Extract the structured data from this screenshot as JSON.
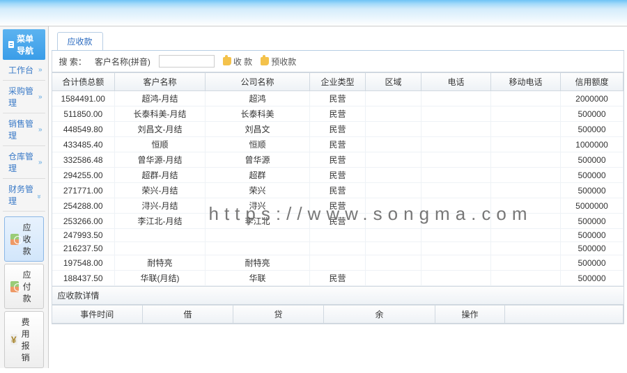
{
  "sidebar": {
    "title": "菜单导航",
    "items": [
      {
        "label": "工作台",
        "open": false
      },
      {
        "label": "采购管理",
        "open": false
      },
      {
        "label": "销售管理",
        "open": false
      },
      {
        "label": "仓库管理",
        "open": false
      },
      {
        "label": "财务管理",
        "open": true
      }
    ],
    "sub": [
      {
        "label": "应收款",
        "icon": "money",
        "active": true
      },
      {
        "label": "应付款",
        "icon": "money",
        "active": false
      },
      {
        "label": "费用报销",
        "icon": "yen",
        "active": false
      }
    ]
  },
  "tabs": {
    "active": "应收款"
  },
  "search": {
    "label": "搜 索：",
    "field_label": "客户名称(拼音)",
    "value": "",
    "action1": "收 款",
    "action2": "预收款"
  },
  "grid": {
    "columns": [
      "合计债总额",
      "客户名称",
      "公司名称",
      "企业类型",
      "区域",
      "电话",
      "移动电话",
      "信用额度"
    ],
    "rows": [
      {
        "amt": "1584491.00",
        "cust": "超鸿-月结",
        "comp": "超鸿",
        "type": "民营",
        "area": "",
        "tel": "",
        "mob": "",
        "cred": "2000000"
      },
      {
        "amt": "511850.00",
        "cust": "长泰科美-月结",
        "comp": "长泰科美",
        "type": "民营",
        "area": "",
        "tel": "",
        "mob": "",
        "cred": "500000"
      },
      {
        "amt": "448549.80",
        "cust": "刘昌文-月结",
        "comp": "刘昌文",
        "type": "民营",
        "area": "",
        "tel": "",
        "mob": "",
        "cred": "500000"
      },
      {
        "amt": "433485.40",
        "cust": "恒顺",
        "comp": "恒顺",
        "type": "民营",
        "area": "",
        "tel": "",
        "mob": "",
        "cred": "1000000"
      },
      {
        "amt": "332586.48",
        "cust": "曾华源-月结",
        "comp": "曾华源",
        "type": "民营",
        "area": "",
        "tel": "",
        "mob": "",
        "cred": "500000"
      },
      {
        "amt": "294255.00",
        "cust": "超群-月结",
        "comp": "超群",
        "type": "民营",
        "area": "",
        "tel": "",
        "mob": "",
        "cred": "500000"
      },
      {
        "amt": "271771.00",
        "cust": "荣兴-月结",
        "comp": "荣兴",
        "type": "民营",
        "area": "",
        "tel": "",
        "mob": "",
        "cred": "500000"
      },
      {
        "amt": "254288.00",
        "cust": "浔兴-月结",
        "comp": "浔兴",
        "type": "民营",
        "area": "",
        "tel": "",
        "mob": "",
        "cred": "5000000"
      },
      {
        "amt": "253266.00",
        "cust": "李江北-月结",
        "comp": "李江北",
        "type": "民营",
        "area": "",
        "tel": "",
        "mob": "",
        "cred": "500000"
      },
      {
        "amt": "247993.50",
        "cust": "",
        "comp": "",
        "type": "",
        "area": "",
        "tel": "",
        "mob": "",
        "cred": "500000"
      },
      {
        "amt": "216237.50",
        "cust": "",
        "comp": "",
        "type": "",
        "area": "",
        "tel": "",
        "mob": "",
        "cred": "500000"
      },
      {
        "amt": "197548.00",
        "cust": "耐特亮",
        "comp": "耐特亮",
        "type": "",
        "area": "",
        "tel": "",
        "mob": "",
        "cred": "500000"
      },
      {
        "amt": "188437.50",
        "cust": "华联(月结)",
        "comp": "华联",
        "type": "民营",
        "area": "",
        "tel": "",
        "mob": "",
        "cred": "500000"
      }
    ]
  },
  "detail": {
    "title": "应收款详情",
    "columns": [
      "事件时间",
      "借",
      "贷",
      "余",
      "操作"
    ]
  },
  "watermark": "https://www.songma.com"
}
